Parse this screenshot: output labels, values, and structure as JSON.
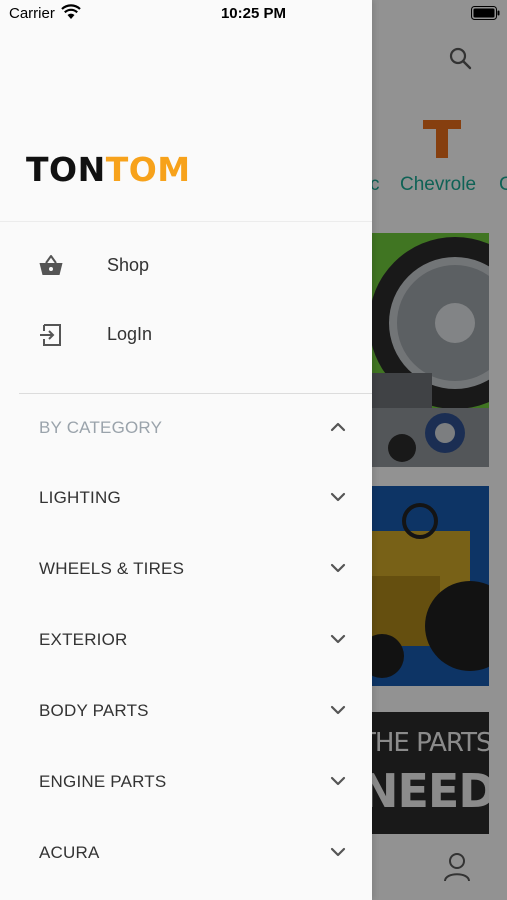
{
  "status_bar": {
    "carrier": "Carrier",
    "time": "10:25 PM"
  },
  "drawer": {
    "logo": {
      "part1": "TON",
      "part2": "TOM"
    },
    "nav": [
      {
        "label": "Shop",
        "icon": "shopping-basket-icon"
      },
      {
        "label": "LogIn",
        "icon": "login-icon"
      }
    ],
    "category_header": {
      "label": "BY CATEGORY",
      "expanded": true
    },
    "categories": [
      {
        "label": "LIGHTING"
      },
      {
        "label": "WHEELS & TIRES"
      },
      {
        "label": "EXTERIOR"
      },
      {
        "label": "BODY PARTS"
      },
      {
        "label": "ENGINE PARTS"
      },
      {
        "label": "ACURA"
      }
    ]
  },
  "background": {
    "brands": [
      "c",
      "Chevrole",
      "C"
    ],
    "banner_3": {
      "line1": "THE PARTS",
      "line2": "NEED"
    },
    "colors": {
      "brand_label": "#1aa38f",
      "logo_accent": "#f7a21b",
      "brand_T": "#e06a1a"
    }
  }
}
